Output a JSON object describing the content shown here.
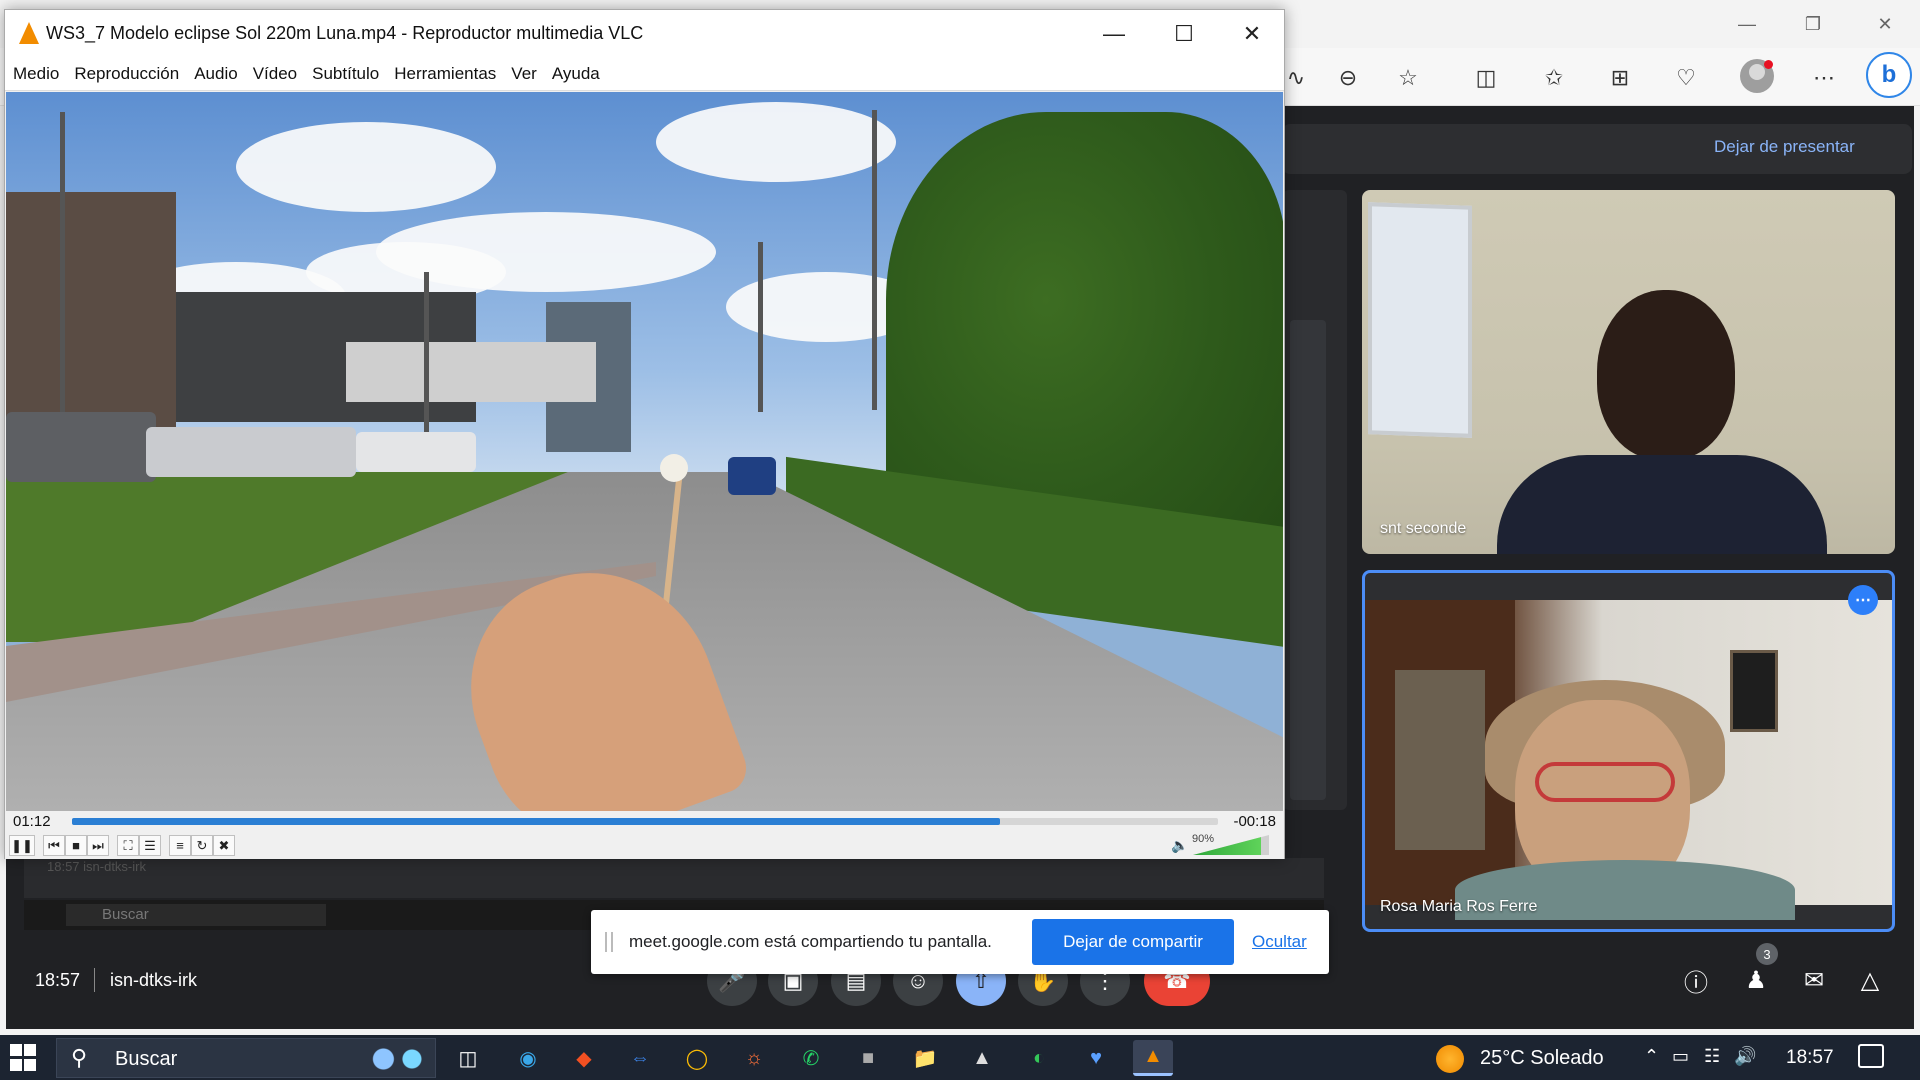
{
  "vlc": {
    "title": "WS3_7 Modelo eclipse Sol 220m Luna.mp4 - Reproductor multimedia VLC",
    "menu": [
      "Medio",
      "Reproducción",
      "Audio",
      "Vídeo",
      "Subtítulo",
      "Herramientas",
      "Ver",
      "Ayuda"
    ],
    "elapsed": "01:12",
    "remaining": "-00:18",
    "progress": 0.81,
    "volume_label": "90%",
    "volume": 0.9
  },
  "meet": {
    "stop_presenting": "Dejar de presentar",
    "participants": [
      {
        "name": "snt seconde"
      },
      {
        "name": "Rosa Maria Ros Ferre"
      }
    ],
    "time": "18:57",
    "meeting_code": "isn-dtks-irk",
    "people_count": "3",
    "mini_preview_text": "18:57   isn-dtks-irk",
    "mini_taskbar_search": "Buscar"
  },
  "share_banner": {
    "message": "meet.google.com está compartiendo tu pantalla.",
    "stop_button": "Dejar de compartir",
    "hide_link": "Ocultar"
  },
  "taskbar": {
    "search_placeholder": "Buscar",
    "weather": "25°C  Soleado",
    "clock": "18:57"
  },
  "colors": {
    "meet_bg": "#202124",
    "meet_accent": "#8ab4f8",
    "share_blue": "#1a73e8",
    "hangup_red": "#ea4335",
    "vlc_progress": "#2b7fd4",
    "taskbar_bg": "#1c2431"
  }
}
